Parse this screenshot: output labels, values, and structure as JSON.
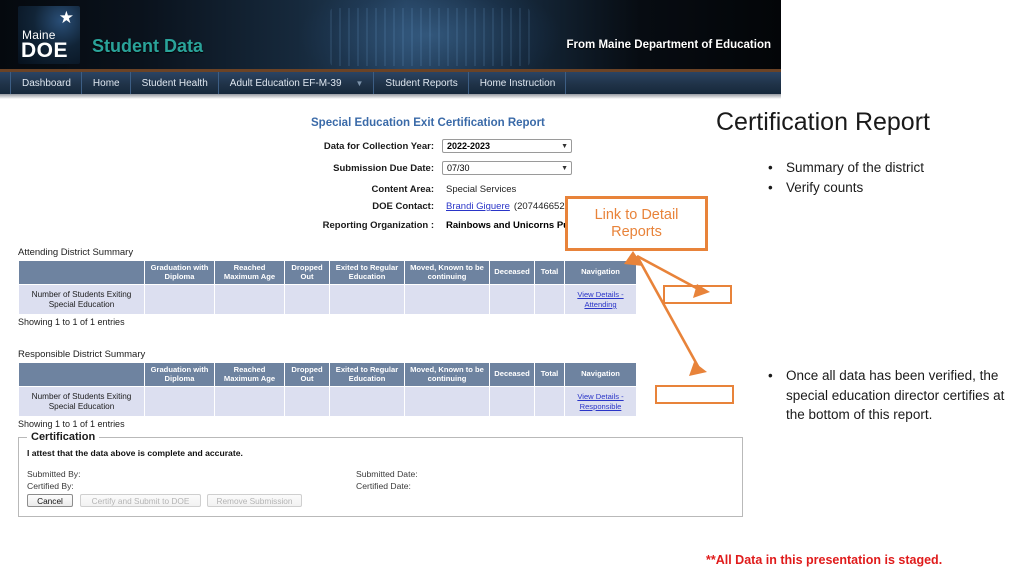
{
  "app": {
    "logo": {
      "line1": "Maine",
      "line2": "DOE",
      "star_icon": "star-icon"
    },
    "title": "Student Data",
    "subtitle": "From Maine Department of Education"
  },
  "nav": {
    "items": [
      {
        "label": "Dashboard",
        "has_caret": false
      },
      {
        "label": "Home",
        "has_caret": false
      },
      {
        "label": "Student Health",
        "has_caret": false
      },
      {
        "label": "Adult Education EF-M-39",
        "has_caret": true
      },
      {
        "label": "Student Reports",
        "has_caret": false
      },
      {
        "label": "Home Instruction",
        "has_caret": false
      }
    ]
  },
  "report": {
    "title": "Special Education Exit Certification Report",
    "fields": {
      "collection_year_label": "Data for Collection Year:",
      "collection_year_value": "2022-2023",
      "due_date_label": "Submission Due Date:",
      "due_date_value": "07/30",
      "content_area_label": "Content Area:",
      "content_area_value": "Special Services",
      "doe_contact_label": "DOE Contact:",
      "doe_contact_name": "Brandi Giguere",
      "doe_contact_phone": "(2074466526)",
      "reporting_org_label": "Reporting Organization :",
      "reporting_org_value": "Rainbows and Unicorns Public Schools"
    }
  },
  "tables": [
    {
      "caption": "Attending District Summary",
      "columns": [
        "",
        "Graduation with Diploma",
        "Reached Maximum Age",
        "Dropped Out",
        "Exited to Regular Education",
        "Moved, Known to be continuing",
        "Deceased",
        "Total",
        "Navigation"
      ],
      "rows": [
        {
          "label": "Number of Students Exiting Special Education",
          "values": [
            "",
            "",
            "",
            "",
            "",
            "",
            ""
          ],
          "link": "View Details - Attending"
        }
      ],
      "footer": "Showing 1 to 1 of 1 entries"
    },
    {
      "caption": "Responsible District Summary",
      "columns": [
        "",
        "Graduation with Diploma",
        "Reached Maximum Age",
        "Dropped Out",
        "Exited to Regular Education",
        "Moved, Known to be continuing",
        "Deceased",
        "Total",
        "Navigation"
      ],
      "rows": [
        {
          "label": "Number of Students Exiting Special Education",
          "values": [
            "",
            "",
            "",
            "",
            "",
            "",
            ""
          ],
          "link": "View Details - Responsible"
        }
      ],
      "footer": "Showing 1 to 1 of 1 entries"
    }
  ],
  "certification": {
    "legend": "Certification",
    "attest": "I attest that the data above is complete and accurate.",
    "submitted_by_label": "Submitted By:",
    "certified_by_label": "Certified By:",
    "submitted_date_label": "Submitted Date:",
    "certified_date_label": "Certified Date:",
    "buttons": [
      {
        "label": "Cancel",
        "enabled": true
      },
      {
        "label": "Certify and Submit to DOE",
        "enabled": false
      },
      {
        "label": "Remove Submission",
        "enabled": false
      }
    ]
  },
  "annotations": {
    "callout": {
      "text": "Link to Detail Reports",
      "color": "#e8833a"
    },
    "slide_title": "Certification Report",
    "bullets_top": [
      "Summary of the district",
      "Verify counts"
    ],
    "bullets_bottom": [
      "Once all data has been verified, the special education director certifies at the bottom of this report."
    ],
    "footer_note": "**All Data in this presentation is staged.",
    "footer_note_color": "#e01b1b"
  }
}
